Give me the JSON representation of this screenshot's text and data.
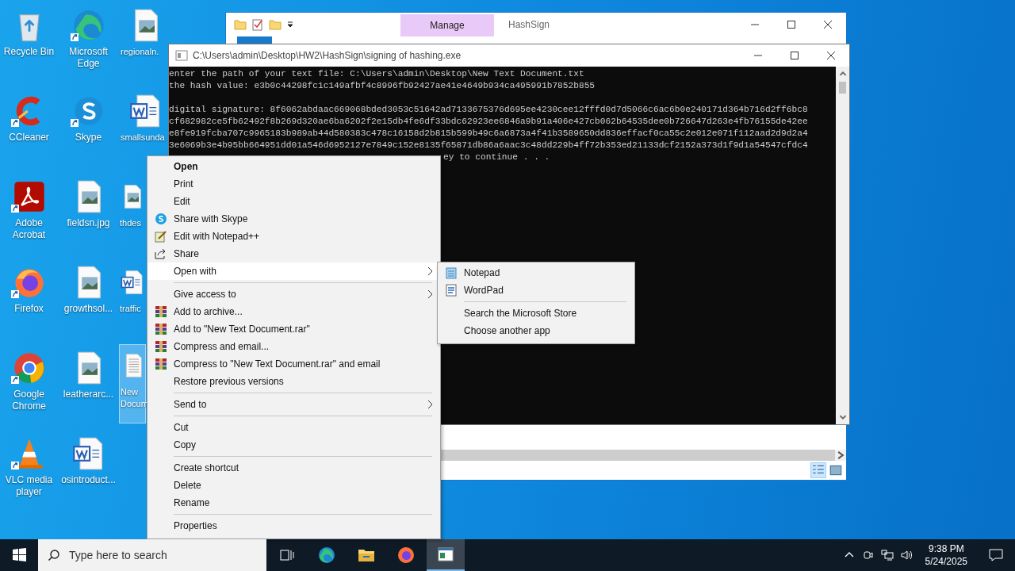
{
  "desktop_icons": [
    {
      "label": "Recycle Bin",
      "kind": "recycle",
      "shortcut": false,
      "selected": false
    },
    {
      "label": "CCleaner",
      "kind": "ccleaner",
      "shortcut": true,
      "selected": false
    },
    {
      "label": "Adobe Acrobat",
      "kind": "acrobat",
      "shortcut": true,
      "selected": false
    },
    {
      "label": "Firefox",
      "kind": "firefox",
      "shortcut": true,
      "selected": false
    },
    {
      "label": "Google Chrome",
      "kind": "chrome",
      "shortcut": true,
      "selected": false
    },
    {
      "label": "VLC media player",
      "kind": "vlc",
      "shortcut": true,
      "selected": false
    },
    {
      "label": "Microsoft Edge",
      "kind": "edge",
      "shortcut": true,
      "selected": false
    },
    {
      "label": "Skype",
      "kind": "skype",
      "shortcut": true,
      "selected": false
    },
    {
      "label": "fieldsn.jpg",
      "kind": "image",
      "shortcut": false,
      "selected": false
    },
    {
      "label": "growthsol...",
      "kind": "image",
      "shortcut": false,
      "selected": false
    },
    {
      "label": "leatherarc...",
      "kind": "image",
      "shortcut": false,
      "selected": false
    },
    {
      "label": "osintroduct...",
      "kind": "word",
      "shortcut": false,
      "selected": false
    },
    {
      "label": "regionaln.",
      "kind": "image",
      "shortcut": false,
      "selected": false
    },
    {
      "label": "smallsunda",
      "kind": "word",
      "shortcut": false,
      "selected": false
    },
    {
      "label": "thdes",
      "kind": "image",
      "shortcut": false,
      "selected": false
    },
    {
      "label": "traffic",
      "kind": "word",
      "shortcut": false,
      "selected": false
    },
    {
      "label": "New Docum",
      "kind": "text",
      "shortcut": false,
      "selected": true
    }
  ],
  "explorer_window": {
    "ribbon_tab": "Manage",
    "title": "HashSign"
  },
  "console_window": {
    "title": "C:\\Users\\admin\\Desktop\\HW2\\HashSign\\signing of hashing.exe",
    "lines": [
      "enter the path of your text file: C:\\Users\\admin\\Desktop\\New Text Document.txt",
      "the hash value: e3b0c44298fc1c149afbf4c8996fb92427ae41e4649b934ca495991b7852b855"
    ],
    "signature_lines": [
      "digital signature: 8f6062abdaac669068bded3053c51642ad7133675376d695ee4230cee12fffd0d7d5066c6ac6b0e240171d364b716d2ff6bc8",
      "cf682982ce5fb62492f8b269d320ae6ba6202f2e15db4fe6df33bdc62923ee6846a9b91a406e427cb062b64535dee0b726647d263e4fb76155de42ee",
      "e8fe919fcba707c9965183b989ab44d580383c478c16158d2b815b599b49c6a6873a4f41b3589650dd836effacf0ca55c2e012e071f112aad2d9d2a4",
      "3e6069b3e4b95bb664951dd01a546d6952127e7849c152e8135f65871db86a6aac3c48dd229b4ff72b353ed21133dcf2152a373d1f9d1a54547cfdc4"
    ],
    "continue_text": "ey to continue . . ."
  },
  "context_menu": {
    "items": [
      {
        "label": "Open",
        "kind": "plain",
        "default": true,
        "submenu": false,
        "selected": false
      },
      {
        "label": "Print",
        "kind": "plain",
        "default": false,
        "submenu": false,
        "selected": false
      },
      {
        "label": "Edit",
        "kind": "plain",
        "default": false,
        "submenu": false,
        "selected": false
      },
      {
        "label": "Share with Skype",
        "kind": "skype",
        "default": false,
        "submenu": false,
        "selected": false
      },
      {
        "label": "Edit with Notepad++",
        "kind": "notepadpp",
        "default": false,
        "submenu": false,
        "selected": false
      },
      {
        "label": "Share",
        "kind": "share",
        "default": false,
        "submenu": false,
        "selected": false
      },
      {
        "label": "Open with",
        "kind": "plain",
        "default": false,
        "submenu": true,
        "selected": true
      },
      {
        "kind": "separator"
      },
      {
        "label": "Give access to",
        "kind": "plain",
        "default": false,
        "submenu": true,
        "selected": false
      },
      {
        "label": "Add to archive...",
        "kind": "archive",
        "default": false,
        "submenu": false,
        "selected": false
      },
      {
        "label": "Add to \"New Text Document.rar\"",
        "kind": "archive",
        "default": false,
        "submenu": false,
        "selected": false
      },
      {
        "label": "Compress and email...",
        "kind": "archive",
        "default": false,
        "submenu": false,
        "selected": false
      },
      {
        "label": "Compress to \"New Text Document.rar\" and email",
        "kind": "archive",
        "default": false,
        "submenu": false,
        "selected": false
      },
      {
        "label": "Restore previous versions",
        "kind": "plain",
        "default": false,
        "submenu": false,
        "selected": false
      },
      {
        "kind": "separator"
      },
      {
        "label": "Send to",
        "kind": "plain",
        "default": false,
        "submenu": true,
        "selected": false
      },
      {
        "kind": "separator"
      },
      {
        "label": "Cut",
        "kind": "plain",
        "default": false,
        "submenu": false,
        "selected": false
      },
      {
        "label": "Copy",
        "kind": "plain",
        "default": false,
        "submenu": false,
        "selected": false
      },
      {
        "kind": "separator"
      },
      {
        "label": "Create shortcut",
        "kind": "plain",
        "default": false,
        "submenu": false,
        "selected": false
      },
      {
        "label": "Delete",
        "kind": "plain",
        "default": false,
        "submenu": false,
        "selected": false
      },
      {
        "label": "Rename",
        "kind": "plain",
        "default": false,
        "submenu": false,
        "selected": false
      },
      {
        "kind": "separator"
      },
      {
        "label": "Properties",
        "kind": "plain",
        "default": false,
        "submenu": false,
        "selected": false
      }
    ]
  },
  "submenu": {
    "items": [
      {
        "label": "Notepad",
        "kind": "notepad"
      },
      {
        "label": "WordPad",
        "kind": "wordpad"
      },
      {
        "kind": "separator"
      },
      {
        "label": "Search the Microsoft Store",
        "kind": "plain"
      },
      {
        "label": "Choose another app",
        "kind": "plain"
      }
    ]
  },
  "taskbar": {
    "search": {
      "placeholder": "Type here to search"
    },
    "apps": [
      {
        "kind": "taskview",
        "active": false
      },
      {
        "kind": "edge",
        "active": false
      },
      {
        "kind": "folder",
        "active": false
      },
      {
        "kind": "firefox",
        "active": false
      },
      {
        "kind": "console",
        "active": true
      }
    ],
    "time": "9:38 PM",
    "date": "5/24/2025"
  }
}
